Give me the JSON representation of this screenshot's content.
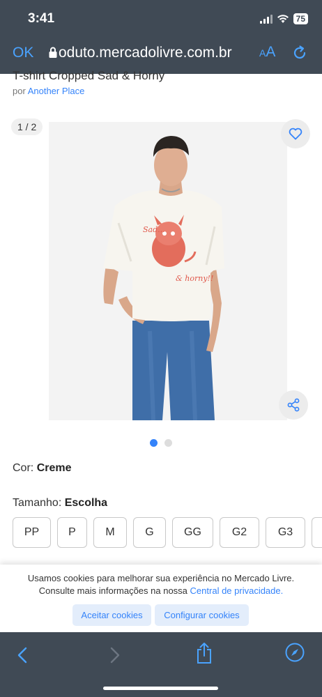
{
  "status": {
    "time": "3:41",
    "battery": "75"
  },
  "browser": {
    "done_label": "OK",
    "url": "oduto.mercadolivre.com.br",
    "aa_small": "A",
    "aa_large": "A"
  },
  "product": {
    "title": "T-shirt Cropped Sad & Horny",
    "by_prefix": "por",
    "brand": "Another Place",
    "image_counter": "1 / 2",
    "print_text_1": "Sad...",
    "print_text_2": "& horny!!"
  },
  "color": {
    "label": "Cor:",
    "value": "Creme"
  },
  "size": {
    "label": "Tamanho:",
    "value": "Escolha",
    "options": [
      "PP",
      "P",
      "M",
      "G",
      "GG",
      "G2",
      "G3"
    ]
  },
  "cookie": {
    "line1": "Usamos cookies para melhorar sua experiência no Mercado Livre.",
    "line2": "Consulte mais informações na nossa",
    "link": "Central de privacidade.",
    "accept": "Aceitar cookies",
    "configure": "Configurar cookies"
  },
  "colors": {
    "bar": "#404a55",
    "accent": "#3483fa",
    "safari_blue": "#4aa3ff"
  },
  "icons": [
    "lock-icon",
    "reload-icon",
    "heart-icon",
    "share-icon",
    "back-icon",
    "forward-icon",
    "share-sheet-icon",
    "compass-icon"
  ]
}
